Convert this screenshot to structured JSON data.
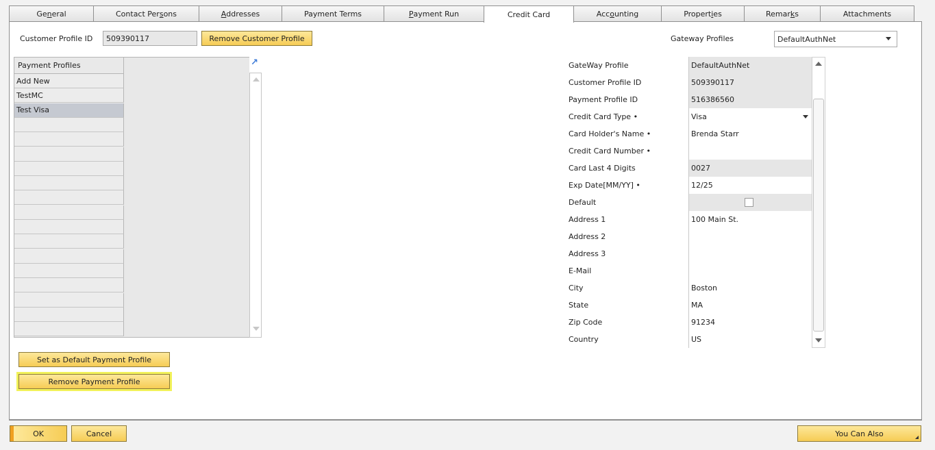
{
  "tabs": [
    {
      "pre": "Ge",
      "u": "n",
      "post": "eral"
    },
    {
      "pre": "Contact Per",
      "u": "s",
      "post": "ons"
    },
    {
      "pre": "",
      "u": "A",
      "post": "ddresses"
    },
    {
      "pre": "Payment Terms",
      "u": "",
      "post": ""
    },
    {
      "pre": "",
      "u": "P",
      "post": "ayment Run"
    },
    {
      "pre": "Credit Card",
      "u": "",
      "post": ""
    },
    {
      "pre": "Acc",
      "u": "o",
      "post": "unting"
    },
    {
      "pre": "Propert",
      "u": "i",
      "post": "es"
    },
    {
      "pre": "Remar",
      "u": "k",
      "post": "s"
    },
    {
      "pre": "Attachments",
      "u": "",
      "post": ""
    }
  ],
  "header": {
    "customer_profile_label": "Customer Profile ID",
    "customer_profile_value": "509390117",
    "remove_customer_profile": "Remove Customer Profile",
    "gateway_profiles_label": "Gateway Profiles",
    "gateway_profiles_value": "DefaultAuthNet"
  },
  "payment_profiles": {
    "header": "Payment Profiles",
    "rows": [
      "Add New",
      "TestMC",
      "Test Visa",
      "",
      "",
      "",
      "",
      "",
      "",
      "",
      "",
      "",
      "",
      "",
      "",
      "",
      "",
      ""
    ],
    "selected_index": 2
  },
  "details": [
    {
      "label": "GateWay Profile",
      "value": "DefaultAuthNet",
      "readonly": true
    },
    {
      "label": "Customer Profile ID",
      "value": "509390117",
      "readonly": true
    },
    {
      "label": "Payment Profile ID",
      "value": "516386560",
      "readonly": true
    },
    {
      "label": "Credit Card Type •",
      "value": "Visa",
      "dropdown": true
    },
    {
      "label": "Card Holder's Name •",
      "value": "Brenda Starr"
    },
    {
      "label": "Credit Card Number •",
      "value": ""
    },
    {
      "label": "Card Last 4 Digits",
      "value": "0027",
      "readonly": true
    },
    {
      "label": "Exp Date[MM/YY] •",
      "value": "12/25"
    },
    {
      "label": "Default",
      "value": "",
      "readonly": true,
      "checkbox": true
    },
    {
      "label": "Address 1",
      "value": "100 Main St."
    },
    {
      "label": "Address 2",
      "value": ""
    },
    {
      "label": "Address 3",
      "value": ""
    },
    {
      "label": "E-Mail",
      "value": ""
    },
    {
      "label": "City",
      "value": "Boston"
    },
    {
      "label": "State",
      "value": "MA"
    },
    {
      "label": "Zip Code",
      "value": "91234"
    },
    {
      "label": "Country",
      "value": "US"
    }
  ],
  "actions": {
    "set_default": "Set as Default Payment Profile",
    "remove_payment": "Remove Payment Profile"
  },
  "footer": {
    "ok": "OK",
    "cancel": "Cancel",
    "you_can_also": "You Can Also"
  },
  "colors": {
    "accent_yellow": "#f6cc55",
    "highlight": "#f2f25a",
    "selected_row": "#c5c9d1"
  }
}
